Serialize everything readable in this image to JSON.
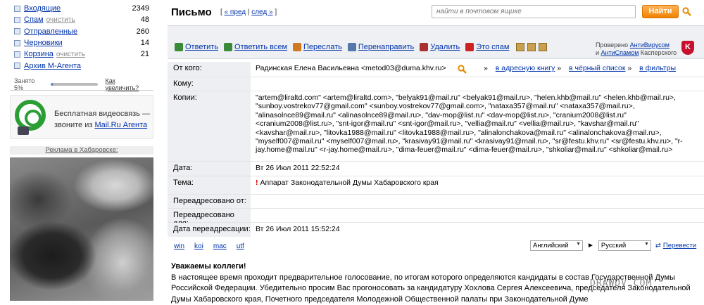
{
  "sidebar": {
    "folders": [
      {
        "name": "Входящие",
        "clear": "",
        "count": "2349"
      },
      {
        "name": "Спам",
        "clear": "очистить",
        "count": "48"
      },
      {
        "name": "Отправленные",
        "clear": "",
        "count": "260"
      },
      {
        "name": "Черновики",
        "clear": "",
        "count": "14"
      },
      {
        "name": "Корзина",
        "clear": "очистить",
        "count": "21"
      },
      {
        "name": "Архив М-Агента",
        "clear": "",
        "count": ""
      }
    ],
    "quota": {
      "label": "Занято 5%",
      "fraction": 0.05,
      "more": "Как увеличить?"
    },
    "promo": {
      "text_line1": "Бесплатная видеосвязь —",
      "text_line2_prefix": "звоните из ",
      "text_link": "Mail.Ru Агента"
    },
    "ad_title": "Реклама в Хабаровске:"
  },
  "header": {
    "title": "Письмо",
    "prev": "« пред",
    "next": "след »",
    "search_placeholder": "найти в почтовом ящике",
    "find_button": "Найти"
  },
  "toolbar": {
    "reply": "Ответить",
    "reply_all": "Ответить всем",
    "forward": "Переслать",
    "redirect": "Перенаправить",
    "delete": "Удалить",
    "spam": "Это спам",
    "av_line1_prefix": "Проверено ",
    "av_line1_link": "АнтиВирусом",
    "av_line2_prefix": "и ",
    "av_line2_link": "АнтиСпамом",
    "av_line2_suffix": " Касперского"
  },
  "message": {
    "labels": {
      "from": "От кого:",
      "to": "Кому:",
      "cc": "Копии:",
      "date": "Дата:",
      "subject": "Тема:",
      "forwarded_from": "Переадресовано от:",
      "forwarded_to": "Переадресовано для:",
      "forward_date": "Дата переадресации:"
    },
    "from": "Радинская Елена Васильевна <metod03@duma.khv.ru>",
    "from_links": [
      "в адресную книгу",
      "в чёрный список",
      "в фильтры"
    ],
    "cc": "\"artem@liraltd.com\" <artem@liraltd.com>, \"belyak91@mail.ru\" <belyak91@mail.ru>, \"helen.khb@mail.ru\" <helen.khb@mail.ru>, \"sunboy.vostrekov77@gmail.com\" <sunboy.vostrekov77@gmail.com>, \"nataxa357@mail.ru\" <nataxa357@mail.ru>, \"alinasolnce89@mail.ru\" <alinasolnce89@mail.ru>, \"dav-mop@list.ru\" <dav-mop@list.ru>, \"cranium2008@list.ru\" <cranium2008@list.ru>, \"snt-igor@mail.ru\" <snt-igor@mail.ru>, \"vellia@mail.ru\" <vellia@mail.ru>, \"kavshar@mail.ru\" <kavshar@mail.ru>, \"litovka1988@mail.ru\" <litovka1988@mail.ru>, \"alinalonchakova@mail.ru\" <alinalonchakova@mail.ru>, \"myself007@mail.ru\" <myself007@mail.ru>, \"krasivay91@mail.ru\" <krasivay91@mail.ru>, \"sr@festu.khv.ru\" <sr@festu.khv.ru>, \"r-jay.home@mail.ru\" <r-jay.home@mail.ru>, \"dima-feuer@mail.ru\" <dima-feuer@mail.ru>, \"shkoliar@mail.ru\" <shkoliar@mail.ru>",
    "date": "Вт 26 Июл 2011 22:52:24",
    "subject": "Аппарат Законодательной Думы Хабаровского края",
    "forward_date": "Вт 26 Июл 2011 15:52:24"
  },
  "encodings": [
    "win",
    "koi",
    "mac",
    "utf"
  ],
  "translate": {
    "from_lang": "Английский",
    "to_lang": "Русский",
    "button": "Перевести"
  },
  "body": {
    "greeting": "Уважаемы коллеги!",
    "text": "В настоящее время проходит предварительное голосование, по итогам которого определяются кандидаты в состав Государственной Думы Российской Федерации. Убедительно просим Вас прогоносовать за кандидатуру Хохлова Сергея Алексеевича, председателя Законодательной Думы Хабаровского края, Почетного председателя Молодежной Общественной палаты при Законодательной Думе"
  },
  "watermark": "DRAWDV.COM",
  "colors": {
    "link": "#0033aa",
    "find_button": "#f08200",
    "toolbar_bg": "#eef0f3"
  }
}
